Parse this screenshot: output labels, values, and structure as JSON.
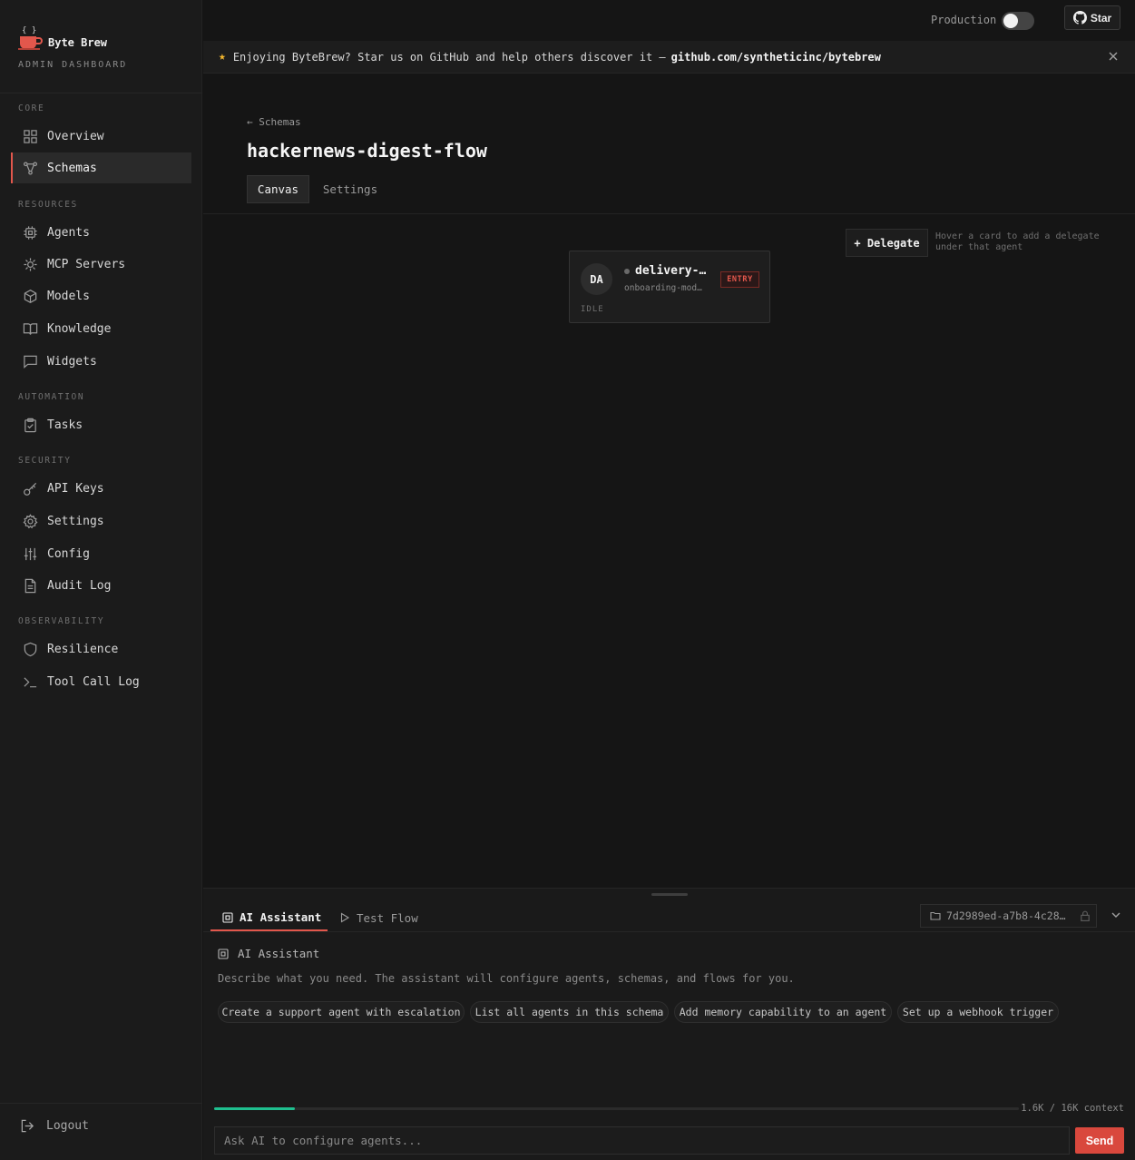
{
  "brand": {
    "name": "Byte Brew",
    "subtitle": "ADMIN DASHBOARD"
  },
  "sidebar": {
    "sections": [
      {
        "label": "CORE"
      },
      {
        "label": "RESOURCES"
      },
      {
        "label": "AUTOMATION"
      },
      {
        "label": "SECURITY"
      },
      {
        "label": "OBSERVABILITY"
      }
    ],
    "items": [
      {
        "label": "Overview",
        "icon": "grid-icon"
      },
      {
        "label": "Schemas",
        "icon": "schema-icon",
        "active": true
      },
      {
        "label": "Agents",
        "icon": "cpu-icon"
      },
      {
        "label": "MCP Servers",
        "icon": "server-icon"
      },
      {
        "label": "Models",
        "icon": "cube-icon"
      },
      {
        "label": "Knowledge",
        "icon": "book-icon"
      },
      {
        "label": "Widgets",
        "icon": "chat-icon"
      },
      {
        "label": "Tasks",
        "icon": "clipboard-icon"
      },
      {
        "label": "API Keys",
        "icon": "key-icon"
      },
      {
        "label": "Settings",
        "icon": "gear-icon"
      },
      {
        "label": "Config",
        "icon": "sliders-icon"
      },
      {
        "label": "Audit Log",
        "icon": "file-icon"
      },
      {
        "label": "Resilience",
        "icon": "shield-icon"
      },
      {
        "label": "Tool Call Log",
        "icon": "terminal-icon"
      }
    ],
    "logout_label": "Logout"
  },
  "topbar": {
    "production_label": "Production",
    "production_on": false,
    "star_label": "Star"
  },
  "banner": {
    "text": "Enjoying ByteBrew? Star us on GitHub and help others discover it —",
    "link": "github.com/syntheticinc/bytebrew"
  },
  "page": {
    "back_label": "← Schemas",
    "title": "hackernews-digest-flow",
    "tabs": [
      "Canvas",
      "Settings"
    ],
    "active_tab": "Canvas"
  },
  "canvas": {
    "delegate_label": "+ Delegate",
    "delegate_hint": "Hover a card to add a delegate under that agent",
    "agent": {
      "initials": "DA",
      "name": "delivery-…",
      "model": "onboarding-mod…",
      "badge": "ENTRY",
      "state": "IDLE"
    }
  },
  "panel": {
    "tabs": [
      "AI Assistant",
      "Test Flow"
    ],
    "active_tab": "AI Assistant",
    "session_id": "7d2989ed-a7b8-4c28…",
    "assistant_title": "AI Assistant",
    "description": "Describe what you need. The assistant will configure agents, schemas, and flows for you.",
    "suggestions": [
      "Create a support agent with escalation",
      "List all agents in this schema",
      "Add memory capability to an agent",
      "Set up a webhook trigger"
    ],
    "context_text": "1.6K / 16K context",
    "context_fraction": 0.1,
    "input_placeholder": "Ask AI to configure agents...",
    "send_label": "Send"
  },
  "colors": {
    "accent": "#e2574c",
    "progress": "#1fbf8f",
    "banner_star": "#f5b82e"
  }
}
